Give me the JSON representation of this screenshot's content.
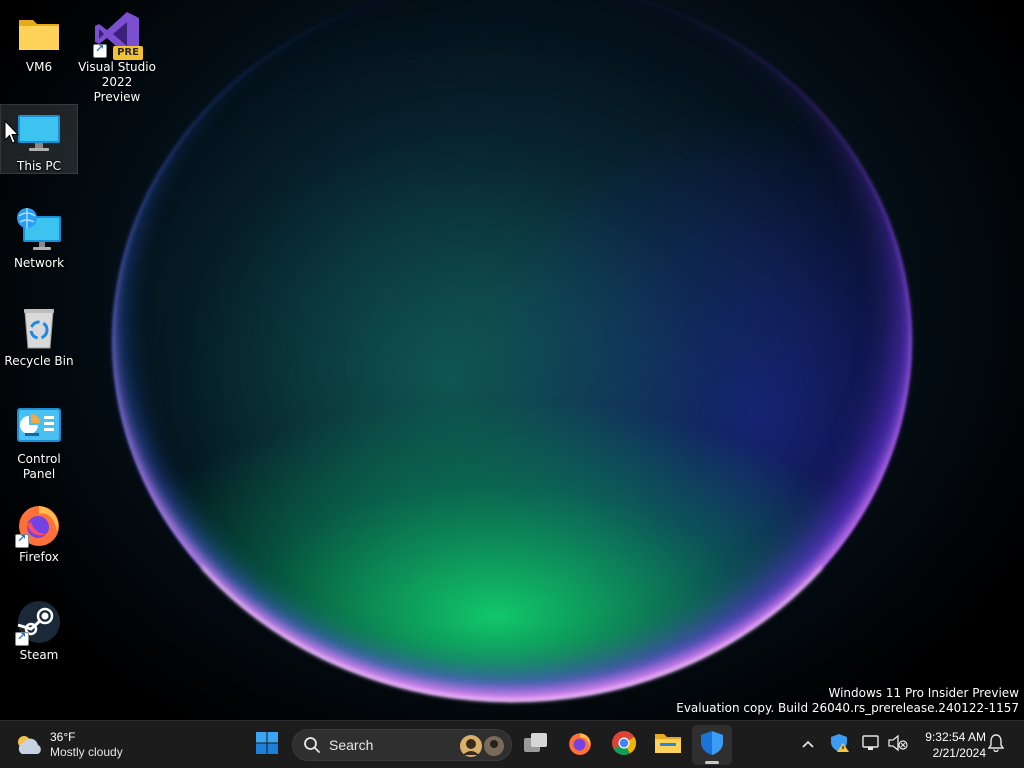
{
  "desktop": {
    "icons": [
      {
        "label": "VM6",
        "icon": "folder-icon"
      },
      {
        "label": "Visual Studio 2022 Preview",
        "icon": "visual-studio-icon",
        "badge": "PRE"
      },
      {
        "label": "This PC",
        "icon": "monitor-icon"
      },
      {
        "label": "Network",
        "icon": "network-icon"
      },
      {
        "label": "Recycle Bin",
        "icon": "recycle-bin-icon"
      },
      {
        "label": "Control Panel",
        "icon": "control-panel-icon"
      },
      {
        "label": "Firefox",
        "icon": "firefox-icon"
      },
      {
        "label": "Steam",
        "icon": "steam-icon"
      }
    ],
    "watermark": {
      "line1": "Windows 11 Pro Insider Preview",
      "line2": "Evaluation copy. Build 26040.rs_prerelease.240122-1157"
    }
  },
  "taskbar": {
    "weather": {
      "temp": "36°F",
      "condition": "Mostly cloudy"
    },
    "search": {
      "label": "Search"
    },
    "apps": [
      "start-icon",
      "task-view-icon",
      "firefox-icon",
      "chrome-icon",
      "file-explorer-icon",
      "defender-icon"
    ],
    "tray": {
      "clock_time": "9:32:54 AM",
      "clock_date": "2/21/2024"
    }
  },
  "colors": {
    "taskbar_bg": "#1c1c1c",
    "accent": "#0078d4",
    "steam": "#1b2838"
  }
}
